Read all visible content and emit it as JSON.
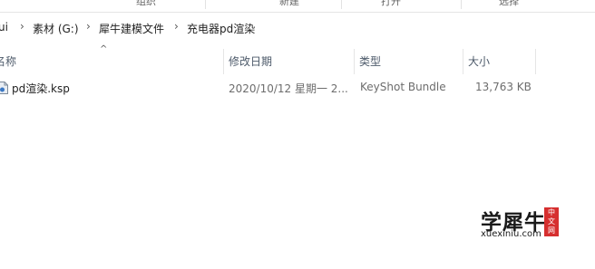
{
  "ribbon": {
    "groups": [
      "组织",
      "新建",
      "打开",
      "选择"
    ]
  },
  "address": {
    "segments": [
      "ui",
      "素材 (G:)",
      "犀牛建模文件",
      "充电器pd渲染"
    ],
    "separator": "›"
  },
  "columns": {
    "sort_indicator": "^",
    "name": "名称",
    "modified": "修改日期",
    "type": "类型",
    "size": "大小"
  },
  "files": [
    {
      "name": "pd渲染.ksp",
      "modified": "2020/10/12 星期一 2...",
      "type": "KeyShot Bundle",
      "size": "13,763 KB",
      "icon": "keyshot-file-icon"
    }
  ],
  "watermark": {
    "title": "学犀牛",
    "url": "xuexiniu.com",
    "badge": "中文网"
  }
}
